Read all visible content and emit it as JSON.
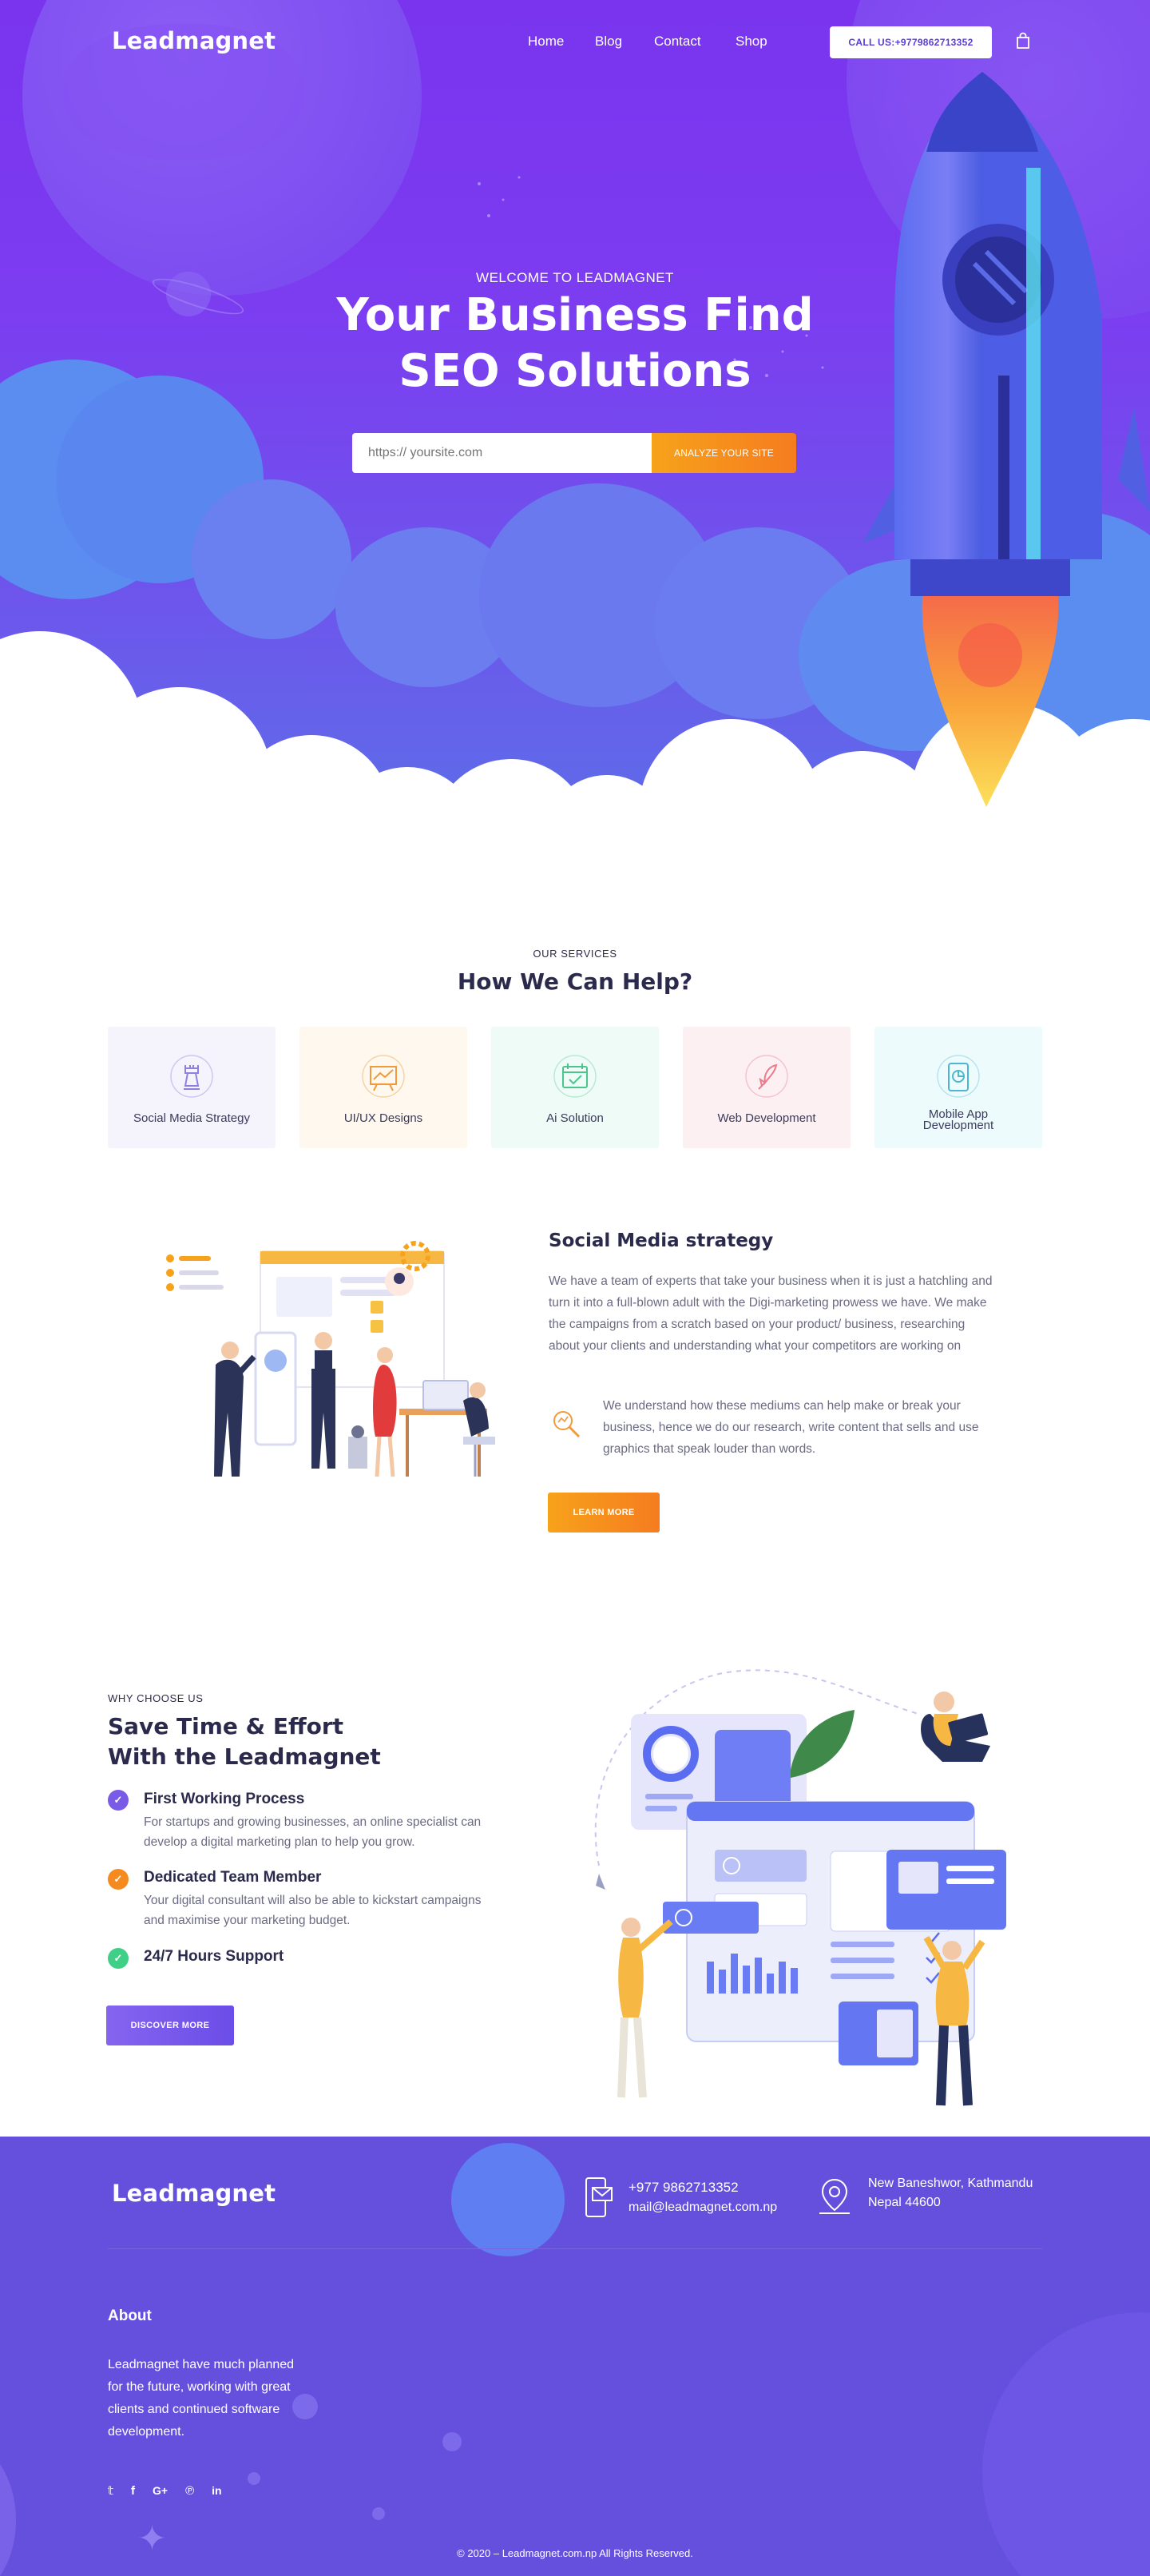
{
  "brand": {
    "name": "Leadmagnet"
  },
  "nav": {
    "items": [
      {
        "label": "Home"
      },
      {
        "label": "Blog"
      },
      {
        "label": "Contact"
      },
      {
        "label": "Shop"
      }
    ],
    "call_label": "CALL US:+9779862713352",
    "cart_icon": "shopping-bag-icon"
  },
  "hero": {
    "welcome": "WELCOME TO LEADMAGNET",
    "title_line1": "Your Business Find",
    "title_line2": "SEO Solutions",
    "search_placeholder": "https:// yoursite.com",
    "analyze_label": "ANALYZE YOUR SITE"
  },
  "services": {
    "eyebrow": "OUR SERVICES",
    "title": "How We Can Help?",
    "items": [
      {
        "label": "Social Media Strategy",
        "icon": "chess-rook-icon",
        "bg": "#f5f3fc",
        "color": "#8e7fe0"
      },
      {
        "label": "UI/UX Designs",
        "icon": "presentation-board-icon",
        "bg": "#fff8ef",
        "color": "#f29a3a"
      },
      {
        "label": "Ai Solution",
        "icon": "calendar-check-icon",
        "bg": "#effbf6",
        "color": "#4cc48d"
      },
      {
        "label": "Web Development",
        "icon": "rocket-launch-icon",
        "bg": "#fdf0f3",
        "color": "#ee7a8c"
      },
      {
        "label": "Mobile App Development",
        "icon": "mobile-chart-icon",
        "bg": "#eefbfd",
        "color": "#4bb7d0"
      }
    ]
  },
  "social_media": {
    "title": "Social Media strategy",
    "para1": "We have a team of experts that take your business when it is just a hatchling and turn it into a full-blown adult with the Digi-marketing prowess we have. We make the campaigns from a scratch based on your product/ business, researching about your clients and understanding what your competitors are working on",
    "para2": "We understand how these mediums can help make or break your business, hence we do our research, write content that sells and use graphics that speak louder than words.",
    "button": "LEARN MORE"
  },
  "why": {
    "eyebrow": "WHY CHOOSE US",
    "title_line1": "Save Time & Effort",
    "title_line2": "With the Leadmagnet",
    "features": [
      {
        "title": "First Working Process",
        "desc": "For startups and growing businesses, an online specialist can develop a digital marketing plan to help you grow.",
        "color": "#7a5be8"
      },
      {
        "title": "Dedicated Team Member",
        "desc": "Your digital consultant will also be able to kickstart campaigns and maximise your marketing budget.",
        "color": "#f58a1f"
      },
      {
        "title": "24/7 Hours Support",
        "desc": "",
        "color": "#3fcf87"
      }
    ],
    "button": "DISCOVER MORE"
  },
  "footer": {
    "phone": "+977 9862713352",
    "email": "mail@leadmagnet.com.np",
    "address_line1": "New Baneshwor, Kathmandu",
    "address_line2": "Nepal 44600",
    "about_title": "About",
    "about_text": "Leadmagnet have much planned for the future, working with great clients and continued software development.",
    "social": [
      {
        "icon": "twitter-icon",
        "glyph": "𝕥"
      },
      {
        "icon": "facebook-icon",
        "glyph": "f"
      },
      {
        "icon": "google-plus-icon",
        "glyph": "G+"
      },
      {
        "icon": "pinterest-icon",
        "glyph": "℗"
      },
      {
        "icon": "linkedin-icon",
        "glyph": "in"
      }
    ],
    "copyright": "© 2020 – Leadmagnet.com.np All Rights Reserved."
  }
}
